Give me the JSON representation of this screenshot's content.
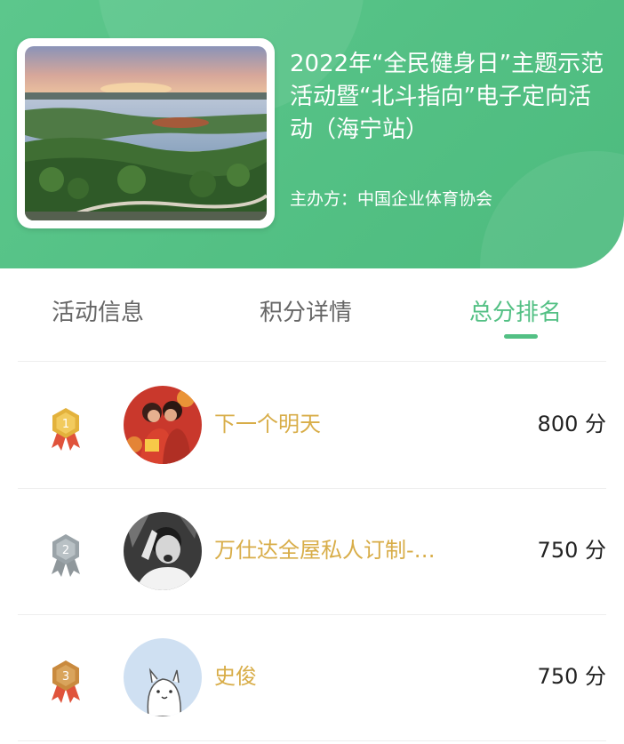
{
  "event": {
    "title": "2022年“全民健身日”主题示范活动暨“北斗指向”电子定向活动（海宁站）",
    "organizer_label": "主办方：",
    "organizer_name": "中国企业体育协会"
  },
  "tabs": [
    {
      "label": "活动信息",
      "active": false
    },
    {
      "label": "积分详情",
      "active": false
    },
    {
      "label": "总分排名",
      "active": true
    }
  ],
  "ranking": [
    {
      "rank": "1",
      "name": "下一个明天",
      "score": "800",
      "unit": "分",
      "medal_color": "#e3b23c"
    },
    {
      "rank": "2",
      "name": "万仕达全屋私人订制-…",
      "score": "750",
      "unit": "分",
      "medal_color": "#9aa3a8"
    },
    {
      "rank": "3",
      "name": "史俊",
      "score": "750",
      "unit": "分",
      "medal_color": "#c98a3e"
    }
  ],
  "colors": {
    "header_green": "#53c084",
    "accent_green": "#53c084",
    "name_gold": "#d8ad48",
    "ribbon_red": "#e0533b"
  }
}
